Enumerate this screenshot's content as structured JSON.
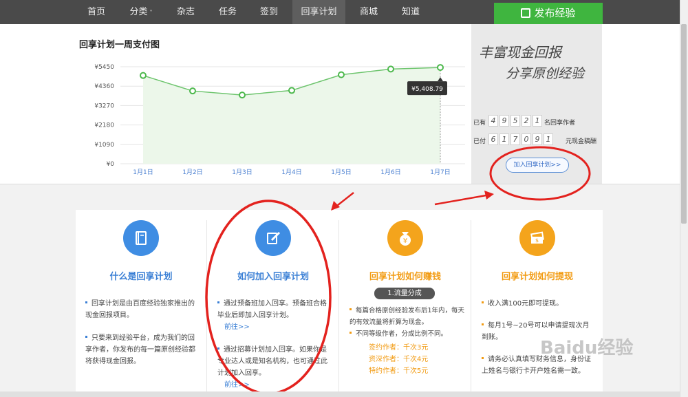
{
  "nav": {
    "items": [
      "首页",
      "分类",
      "杂志",
      "任务",
      "签到",
      "回享计划",
      "商城",
      "知道"
    ],
    "active": "回享计划",
    "publish": "发布经验"
  },
  "chart_title": "回享计划一周支付图",
  "chart_data": {
    "type": "area",
    "categories": [
      "1月1日",
      "1月2日",
      "1月3日",
      "1月4日",
      "1月5日",
      "1月6日",
      "1月7日"
    ],
    "values": [
      4960,
      4090,
      3860,
      4120,
      5000,
      5320,
      5408.79
    ],
    "y_ticks": [
      "¥0",
      "¥1090",
      "¥2180",
      "¥3270",
      "¥4360",
      "¥5450"
    ],
    "ylim": [
      0,
      5450
    ],
    "tooltip": "¥5,408.79",
    "colors": {
      "line": "#6cc46c",
      "fill": "#ecf7ea",
      "point": "#4cb84c"
    }
  },
  "promo": {
    "line1": "丰富现金回报",
    "line2": "分享原创经验",
    "authors_prefix": "已有",
    "authors_digits": [
      "4",
      "9",
      "5",
      "2",
      "1"
    ],
    "authors_suffix": "名回享作者",
    "paid_prefix": "已付",
    "paid_digits": [
      "6",
      "1",
      "7",
      "0",
      "9",
      "1"
    ],
    "paid_suffix": "元现金稿酬",
    "join": "加入回享计划>>"
  },
  "cards": [
    {
      "title": "什么是回享计划",
      "icon": "book-icon",
      "items": [
        "回享计划是由百度经验独家推出的现金回报项目。",
        "只要来到经验平台，成为我们的回享作者，你发布的每一篇原创经验都将获得现金回报。"
      ]
    },
    {
      "title": "如何加入回享计划",
      "icon": "edit-icon",
      "items": [
        "通过预备班加入回享。预备班合格毕业后即加入回享计划。",
        "通过招募计划加入回享。如果你是专业达人或是知名机构，也可通过此计划加入回享。"
      ],
      "links": [
        "前往>>",
        "前往>>"
      ]
    },
    {
      "title": "回享计划如何赚钱",
      "icon": "money-bag-icon",
      "pill": "1.流量分成",
      "items": [
        "每篇合格原创经验发布后1年内，每天的有效流量将折算为现金。",
        "不同等级作者，分成比例不同。"
      ],
      "tiers": [
        "签约作者：千次3元",
        "资深作者：千次4元",
        "特约作者：千次5元"
      ]
    },
    {
      "title": "回享计划如何提现",
      "icon": "cash-icon",
      "items": [
        "收入满100元即可提现。",
        "每月1号~20号可以申请提现次月到账。",
        "请务必认真填写财务信息，身份证上姓名与银行卡开户姓名需一致。"
      ]
    }
  ],
  "watermark": "Baidu经验"
}
